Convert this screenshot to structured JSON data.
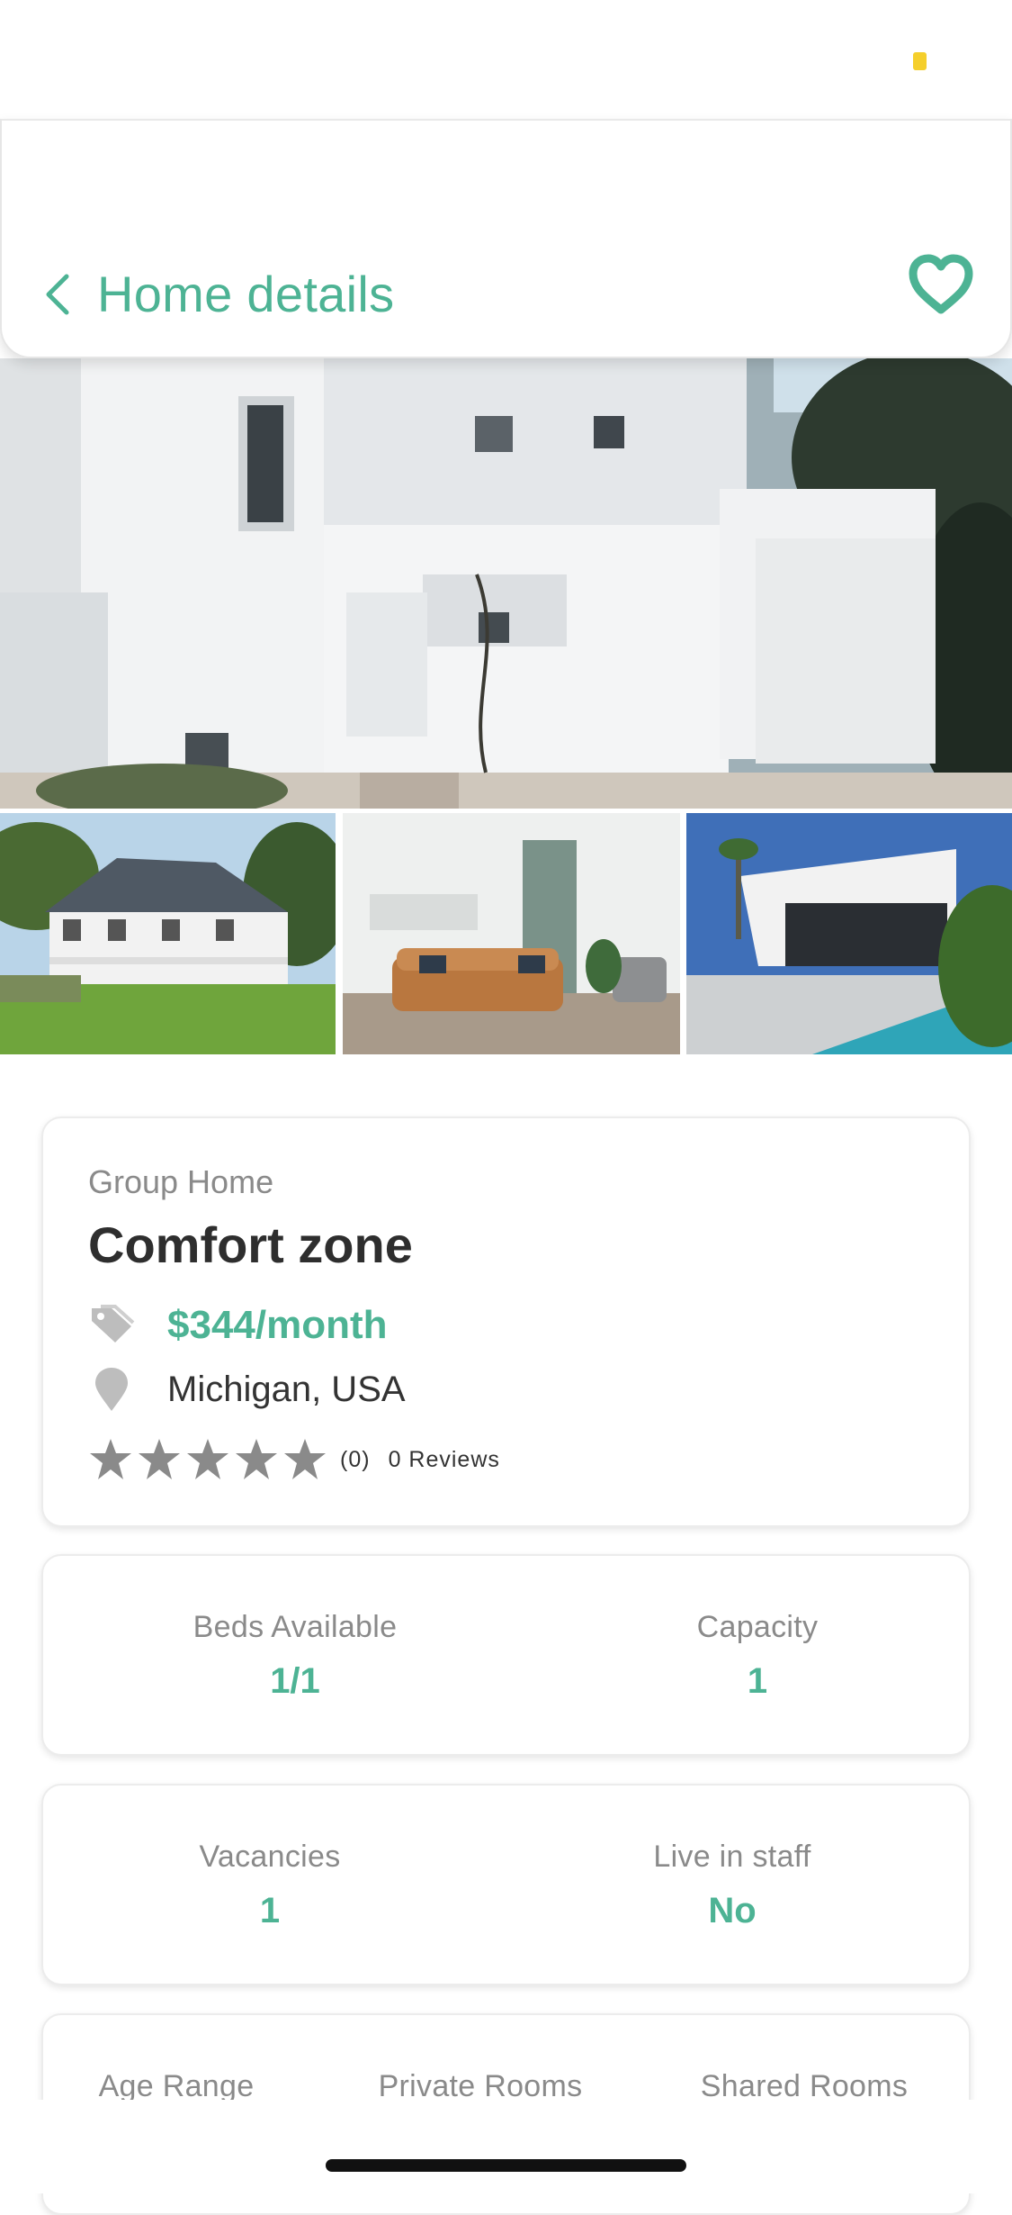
{
  "header": {
    "title": "Home details"
  },
  "listing": {
    "type": "Group Home",
    "name": "Comfort zone",
    "price": "$344/month",
    "location": "Michigan, USA",
    "rating": 0,
    "rating_count": "(0)",
    "reviews": "0 Reviews"
  },
  "stats": {
    "beds_label": "Beds Available",
    "beds_value": "1/1",
    "capacity_label": "Capacity",
    "capacity_value": "1",
    "vacancies_label": "Vacancies",
    "vacancies_value": "1",
    "staff_label": "Live in staff",
    "staff_value": "No",
    "age_label": "Age Range",
    "private_label": "Private Rooms",
    "shared_label": "Shared Rooms"
  },
  "colors": {
    "accent": "#4db394",
    "star": "#8a8a8a"
  },
  "icons": [
    "chevron-left-icon",
    "heart-icon",
    "price-tag-icon",
    "location-pin-icon",
    "star-icon"
  ]
}
